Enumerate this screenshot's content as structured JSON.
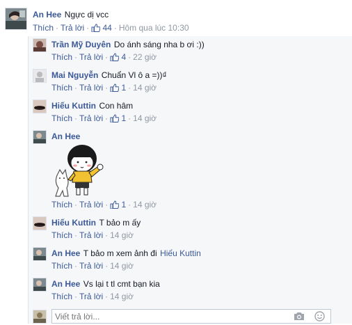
{
  "main_comment": {
    "author": "An Hee",
    "text": "Ngực dị vcc",
    "like_label": "Thích",
    "reply_label": "Trả lời",
    "likes": "44",
    "time": "Hôm qua lúc 10:30"
  },
  "replies": [
    {
      "author": "Trần Mỹ Duyên",
      "text": "Do ánh sáng nha b ơi :))",
      "like_label": "Thích",
      "reply_label": "Trả lời",
      "likes": "4",
      "time": "22 giờ"
    },
    {
      "author": "Mai Nguyễn",
      "text": "Chuẩn Vl ô a =))₫",
      "like_label": "Thích",
      "reply_label": "Trả lời",
      "likes": "1",
      "time": "14 giờ"
    },
    {
      "author": "Hiếu Kuttin",
      "text": "Con hâm",
      "like_label": "Thích",
      "reply_label": "Trả lời",
      "likes": "1",
      "time": "14 giờ"
    },
    {
      "author": "An Hee",
      "text": "",
      "like_label": "Thích",
      "reply_label": "Trả lời",
      "likes": "1",
      "time": "14 giờ"
    },
    {
      "author": "Hiếu Kuttin",
      "text": "T bảo m ấy",
      "like_label": "Thích",
      "reply_label": "Trả lời",
      "time": "14 giờ"
    },
    {
      "author": "An Hee",
      "text": "T bảo m xem ảnh đi",
      "mention": "Hiếu Kuttin",
      "like_label": "Thích",
      "reply_label": "Trả lời",
      "time": "14 giờ"
    },
    {
      "author": "An Hee",
      "text": "Vs lại t tl cmt bạn kia",
      "like_label": "Thích",
      "reply_label": "Trả lời",
      "time": "14 giờ"
    }
  ],
  "reply_box": {
    "placeholder": "Viết trả lời..."
  },
  "icons": [
    "thumbs-up-icon",
    "camera-icon",
    "smiley-icon",
    "avatar",
    "sticker"
  ],
  "colors": {
    "link": "#3b5998",
    "meta": "#9197a3",
    "text": "#141823",
    "reply_bg": "#f6f7f9"
  }
}
